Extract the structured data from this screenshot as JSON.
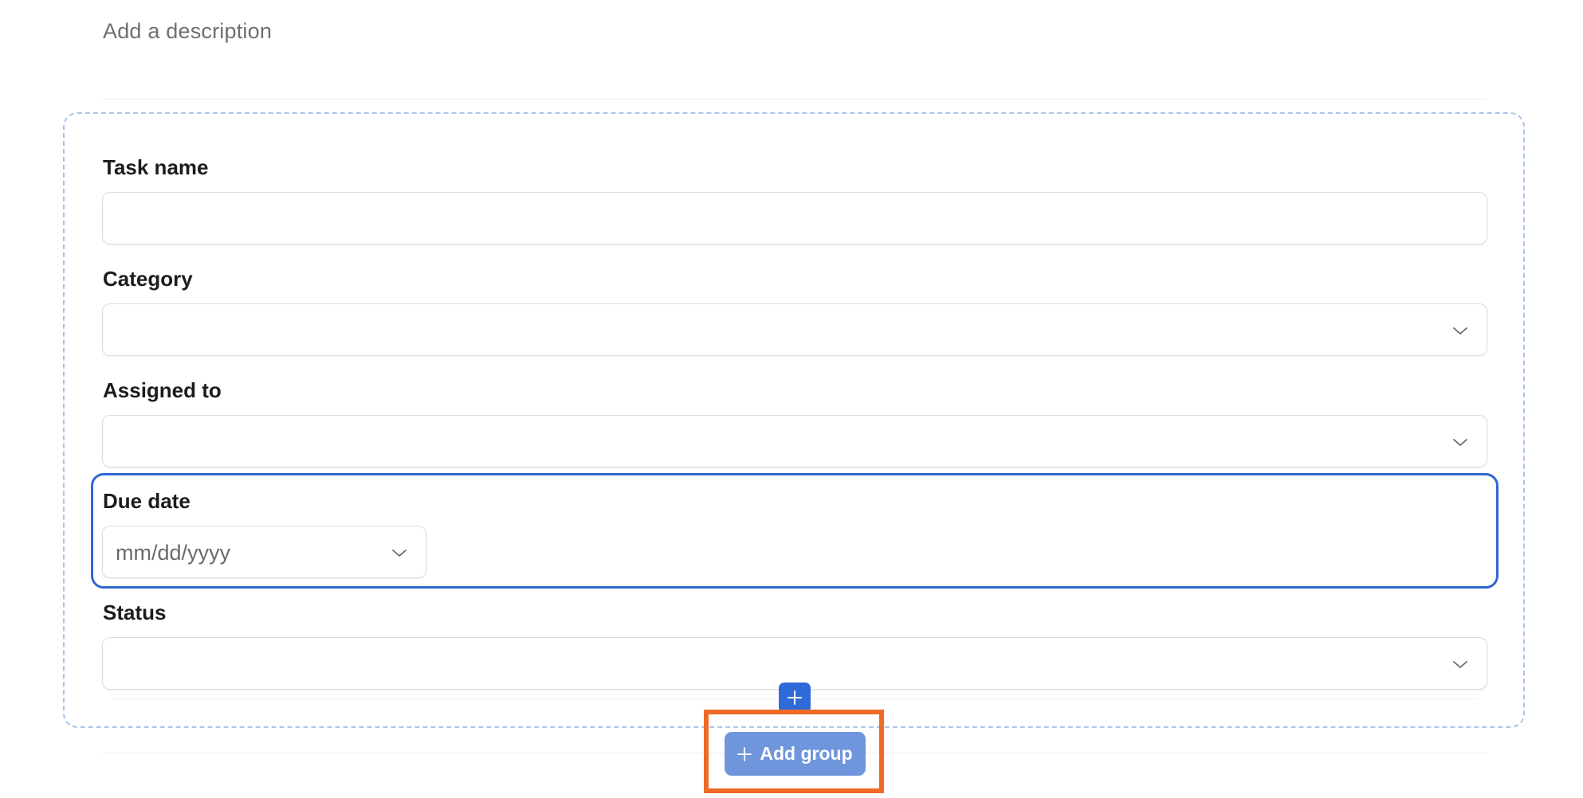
{
  "description": {
    "placeholder": "Add a description"
  },
  "fields": {
    "task_name": {
      "label": "Task name",
      "value": ""
    },
    "category": {
      "label": "Category",
      "value": ""
    },
    "assigned_to": {
      "label": "Assigned to",
      "value": ""
    },
    "due_date": {
      "label": "Due date",
      "placeholder": "mm/dd/yyyy"
    },
    "status": {
      "label": "Status",
      "value": ""
    }
  },
  "actions": {
    "add_group_label": "Add group"
  },
  "icons": {
    "dropdown": "chevron-down-icon",
    "add": "plus-icon"
  },
  "colors": {
    "selection": "#2e67d1",
    "group_border": "#a9c4ec",
    "add_button": "#6f96dc",
    "add_mini": "#2f6bd8",
    "highlight": "#ee6a26"
  }
}
